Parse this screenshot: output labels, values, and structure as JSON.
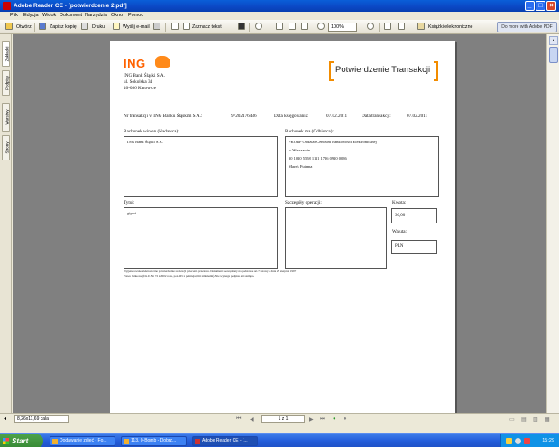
{
  "window": {
    "title": "Adobe Reader CE - [potwierdzenie 2.pdf]"
  },
  "menu": [
    "Plik",
    "Edycja",
    "Widok",
    "Dokument",
    "Narzędzia",
    "Okno",
    "Pomoc"
  ],
  "toolbar": {
    "open": "Otwórz",
    "save": "Zapisz kopię",
    "print": "Drukuj",
    "email": "Wyślij e-mail",
    "select_text": "Zaznacz tekst",
    "zoom": "100%",
    "ebooks": "Książki elektroniczne",
    "adobe": "Do more with Adobe PDF"
  },
  "side_tabs": [
    "Zakładki",
    "Podpisy",
    "Warstwy",
    "Strony"
  ],
  "statusbar": {
    "dimensions": "8,26x11,69 cala",
    "page": "1 z 1"
  },
  "document": {
    "brand": "ING",
    "address": [
      "ING Bank Śląski S.A.",
      "ul. Sokolska 34",
      "40-086 Katowice"
    ],
    "title": "Potwierdzenie Transakcji",
    "tx_label": "Nr transakcji w ING Banku Śląskim S.A.:",
    "tx_number": "97202176436",
    "booking_label": "Data księgowania:",
    "booking_date": "07.02.2011",
    "tx_date_label": "Data transakcji:",
    "tx_date": "07.02.2011",
    "debit_label": "Rachunek winien (Nadawca):",
    "debit_value": "ING Bank Śląski S.A.",
    "credit_label": "Rachunek ma (Odbiorca):",
    "credit_lines": [
      "PKOBP Oddział-Centrum Bankowości Elektronicznej",
      "w Warszawie",
      "30 1020 5558 1111 1726 0910 0086",
      "Marek Futema"
    ],
    "title_label": "Tytuł:",
    "title_value": "gipwi",
    "details_label": "Szczegóły operacji:",
    "amount_label": "Kwota:",
    "amount_value": "30,00",
    "currency_label": "Waluta:",
    "currency_value": "PLN",
    "footnote": [
      "Wygenerowano elektroniczne potwierdzenie realizacji polecenia przelewu. Dokument sporządzony na podstawie art.7 ustawy z dnia 29 sierpnia 1997",
      "Prawo bankowe (Dz.U. Nr 72 z 2002 roku, poz.665 z późniejszymi zmianami). Nie wymaga podpisu ani stempla."
    ]
  },
  "taskbar": {
    "start": "Start",
    "tasks": [
      "Dodawanie zdjęć - Fo...",
      "113. 0-Bomb - Dobrz...",
      "Adobe Reader CE - [..."
    ],
    "clock": "15:29"
  }
}
